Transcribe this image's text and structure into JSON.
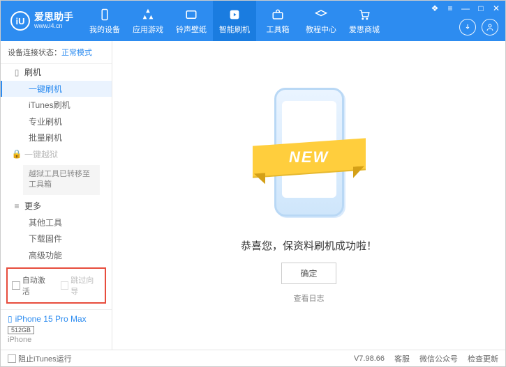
{
  "header": {
    "app_name": "爱思助手",
    "app_url": "www.i4.cn",
    "logo_letters": "iU",
    "nav": [
      {
        "label": "我的设备"
      },
      {
        "label": "应用游戏"
      },
      {
        "label": "铃声壁纸"
      },
      {
        "label": "智能刷机"
      },
      {
        "label": "工具箱"
      },
      {
        "label": "教程中心"
      },
      {
        "label": "爱思商城"
      }
    ]
  },
  "sidebar": {
    "conn_label": "设备连接状态：",
    "conn_mode": "正常模式",
    "group_flash": "刷机",
    "items_flash": [
      "一键刷机",
      "iTunes刷机",
      "专业刷机",
      "批量刷机"
    ],
    "group_jailbreak": "一键越狱",
    "jail_note": "越狱工具已转移至工具箱",
    "group_more": "更多",
    "items_more": [
      "其他工具",
      "下载固件",
      "高级功能"
    ],
    "chk_auto": "自动激活",
    "chk_skip": "跳过向导",
    "device_name": "iPhone 15 Pro Max",
    "device_storage": "512GB",
    "device_type": "iPhone"
  },
  "main": {
    "ribbon": "NEW",
    "success": "恭喜您，保资料刷机成功啦！",
    "ok": "确定",
    "log_link": "查看日志"
  },
  "footer": {
    "block_itunes": "阻止iTunes运行",
    "version": "V7.98.66",
    "links": [
      "客服",
      "微信公众号",
      "检查更新"
    ]
  }
}
